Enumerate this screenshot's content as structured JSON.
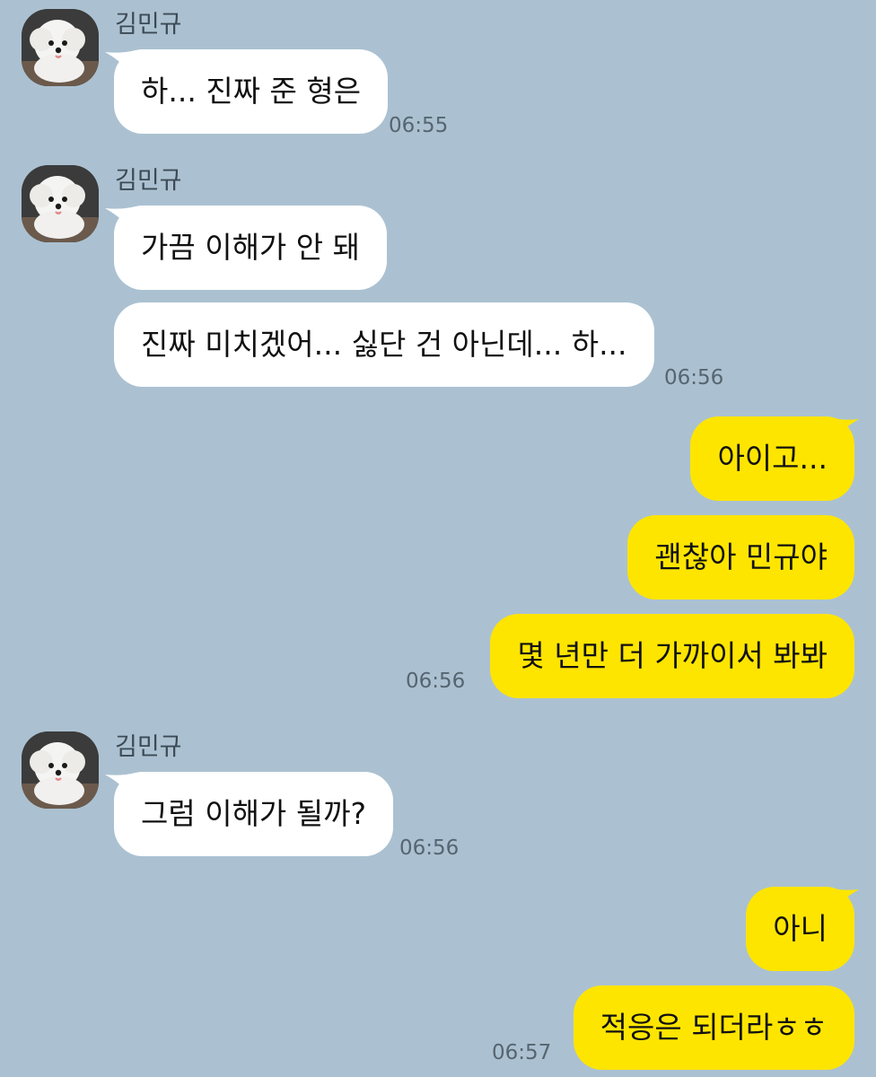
{
  "colors": {
    "background": "#abc1d1",
    "incoming_bubble": "#ffffff",
    "outgoing_bubble": "#fee500"
  },
  "groups": [
    {
      "sender": "김민규",
      "avatar_icon": "white-puppy-avatar",
      "messages": [
        "하... 진짜 준 형은"
      ],
      "time": "06:55"
    },
    {
      "sender": "김민규",
      "avatar_icon": "white-puppy-avatar",
      "messages": [
        "가끔 이해가 안 돼",
        "진짜 미치겠어... 싫단 건 아닌데... 하..."
      ],
      "time": "06:56"
    },
    {
      "sender": "",
      "messages": [
        "아이고...",
        "괜찮아 민규야",
        "몇 년만 더 가까이서 봐봐"
      ],
      "time": "06:56"
    },
    {
      "sender": "김민규",
      "avatar_icon": "white-puppy-avatar",
      "messages": [
        "그럼 이해가 될까?"
      ],
      "time": "06:56"
    },
    {
      "sender": "",
      "messages": [
        "아니",
        "적응은 되더라ㅎㅎ"
      ],
      "time": "06:57"
    }
  ]
}
